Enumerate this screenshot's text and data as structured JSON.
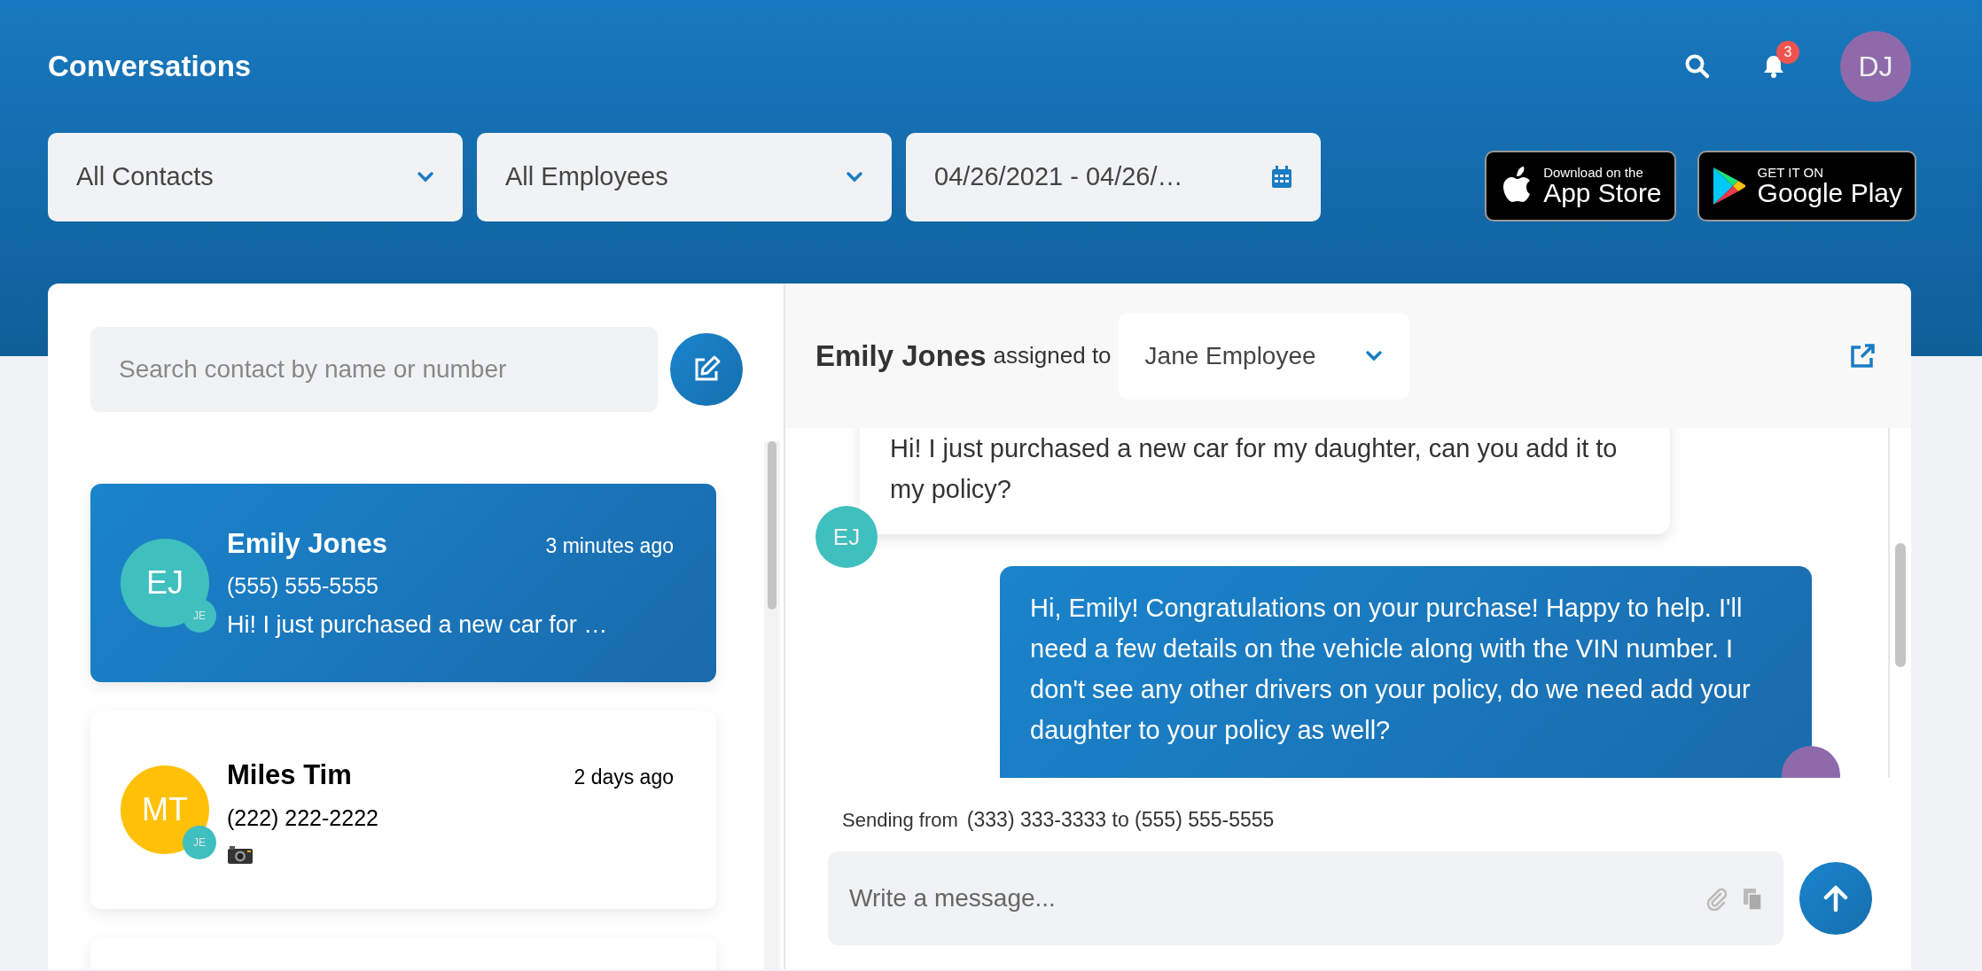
{
  "header": {
    "title": "Conversations",
    "notifications": "3",
    "user_initials": "DJ"
  },
  "filters": [
    {
      "kind": "select",
      "value": "All Contacts"
    },
    {
      "kind": "select",
      "value": "All Employees"
    },
    {
      "kind": "date",
      "value": "04/26/2021 - 04/26/…"
    }
  ],
  "app_badges": [
    {
      "kind": "apple",
      "small": "Download on the",
      "big": "App Store"
    },
    {
      "kind": "google",
      "small": "GET IT ON",
      "big": "Google Play"
    }
  ],
  "contact_search": {
    "placeholder": "Search contact by name or number"
  },
  "contacts": [
    {
      "initials": "EJ",
      "color": "#40bfbf",
      "agent_initials": "JE",
      "name": "Emily Jones",
      "time": "3 minutes ago",
      "phone": "(555) 555-5555",
      "last_message": {
        "kind": "text",
        "text": "Hi! I just purchased a new car for …"
      },
      "selected": true
    },
    {
      "initials": "MT",
      "color": "#ffc107",
      "agent_initials": "JE",
      "name": "Miles Tim",
      "time": "2 days ago",
      "phone": "(222) 222-2222",
      "last_message": {
        "kind": "photo"
      },
      "selected": false
    }
  ],
  "conversation": {
    "contact": "Emily Jones",
    "assigned_label": "assigned to",
    "assignee": "Jane Employee",
    "messages": [
      {
        "kind": "incoming",
        "text": "Hi! I just purchased a new car for my daughter, can you add it to my policy?",
        "avatar": "EJ"
      },
      {
        "kind": "outgoing",
        "text": "Hi, Emily! Congratulations on your purchase! Happy to help. I'll need a few details on the vehicle along with the VIN number. I don't see any other drivers on your policy, do we need add your daughter to your policy as well?"
      }
    ],
    "sending_label": "Sending from",
    "sending_numbers": "(333) 333-3333 to (555) 555-5555",
    "composer": {
      "placeholder": "Write a message..."
    }
  }
}
